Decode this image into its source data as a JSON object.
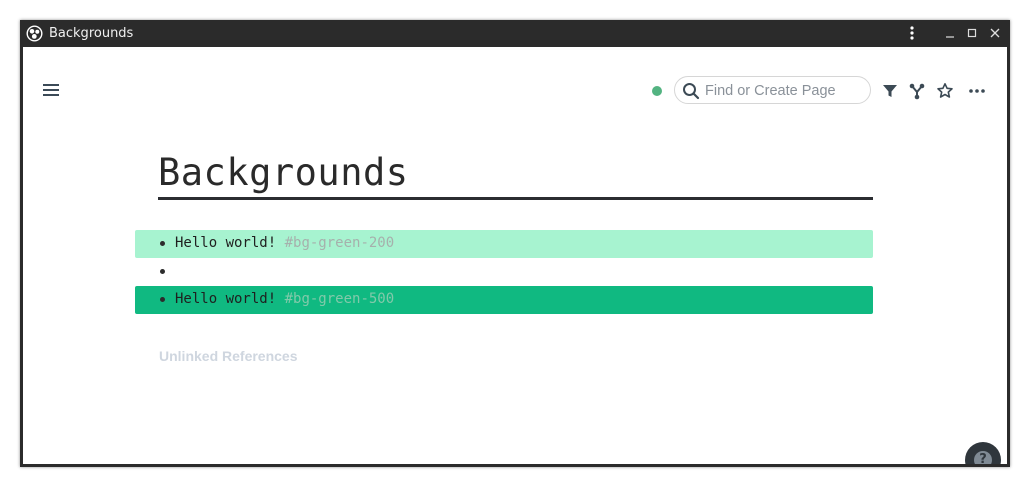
{
  "window": {
    "title": "Backgrounds"
  },
  "header": {
    "search": {
      "placeholder": "Find or Create Page",
      "value": ""
    },
    "sync_status_color": "#53b381",
    "icons": [
      "menu-icon",
      "search-icon",
      "filter-icon",
      "graph-icon",
      "star-icon",
      "more-icon"
    ]
  },
  "page": {
    "title": "Backgrounds",
    "blocks": [
      {
        "text": "Hello world!",
        "tag": "#bg-green-200",
        "background": "#a7f3d0"
      },
      {
        "text": "",
        "tag": "",
        "background": ""
      },
      {
        "text": "Hello world!",
        "tag": "#bg-green-500",
        "background": "#10b981"
      }
    ],
    "unlinked_references_label": "Unlinked References"
  },
  "help": {
    "label": "?"
  }
}
